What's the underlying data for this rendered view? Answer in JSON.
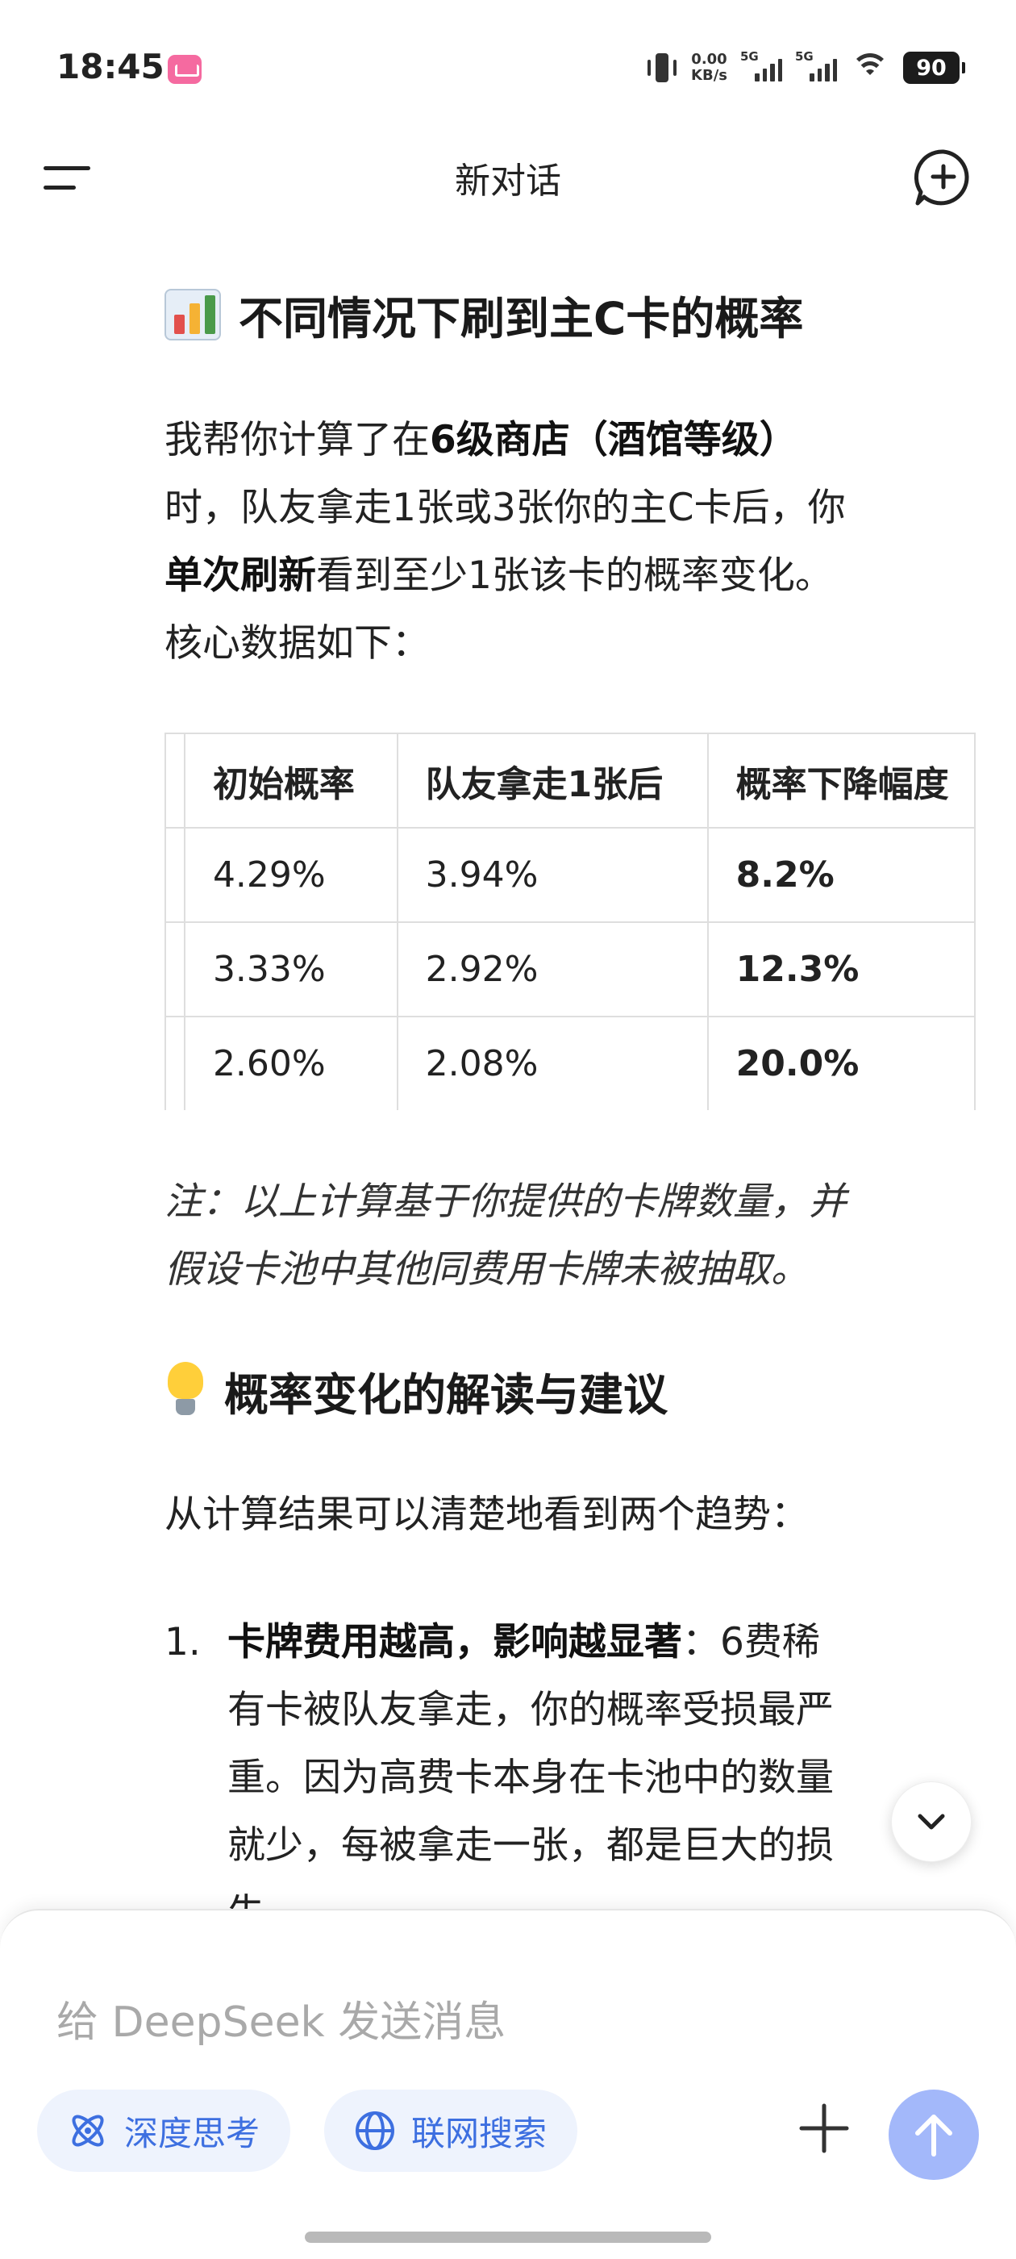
{
  "status_bar": {
    "time": "18:45",
    "net_speed_value": "0.00",
    "net_speed_unit": "KB/s",
    "signal1_label": "5G",
    "signal2_label": "5G",
    "battery": "90"
  },
  "header": {
    "title": "新对话"
  },
  "content": {
    "heading1": "不同情况下刷到主C卡的概率",
    "intro_lines": [
      [
        {
          "t": "我帮你计算了在",
          "b": false
        },
        {
          "t": "6级商店（酒馆等级）",
          "b": true
        }
      ],
      [
        {
          "t": "时，队友拿走1张或3张你的主C卡后，你",
          "b": false
        }
      ],
      [
        {
          "t": "单次刷新",
          "b": true
        },
        {
          "t": "看到至少1张该卡的概率变化。",
          "b": false
        }
      ],
      [
        {
          "t": "核心数据如下：",
          "b": false
        }
      ]
    ],
    "table": {
      "headers": [
        "",
        "初始概率",
        "队友拿走1张后",
        "概率下降幅度"
      ],
      "rows": [
        [
          "",
          "4.29%",
          "3.94%",
          "8.2%"
        ],
        [
          "",
          "3.33%",
          "2.92%",
          "12.3%"
        ],
        [
          "",
          "2.60%",
          "2.08%",
          "20.0%"
        ]
      ]
    },
    "note_lines": [
      "注：以上计算基于你提供的卡牌数量，并",
      "假设卡池中其他同费用卡牌未被抽取。"
    ],
    "heading2": "概率变化的解读与建议",
    "para2": "从计算结果可以清楚地看到两个趋势：",
    "list": [
      {
        "num": "1.",
        "lines": [
          [
            {
              "t": "卡牌费用越高，影响越显著",
              "b": true
            },
            {
              "t": "：6费稀",
              "b": false
            }
          ],
          [
            {
              "t": "有卡被队友拿走，你的概率受损最严",
              "b": false
            }
          ],
          [
            {
              "t": "重。因为高费卡本身在卡池中的数量",
              "b": false
            }
          ],
          [
            {
              "t": "就少，每被拿走一张，都是巨大的损",
              "b": false
            }
          ],
          [
            {
              "t": "失。",
              "b": false
            }
          ]
        ]
      }
    ]
  },
  "input": {
    "placeholder": "给 DeepSeek 发送消息",
    "chip_deep_think": "深度思考",
    "chip_web_search": "联网搜索"
  },
  "icons": {
    "menu": "menu-icon",
    "new_chat": "new-chat-icon",
    "scroll_down": "chevron-down-icon",
    "deep_think": "atom-icon",
    "web_search": "globe-icon",
    "plus": "plus-icon",
    "send": "arrow-up-icon"
  },
  "colors": {
    "accent": "#3d6fe0",
    "chip_bg": "#eef3fd",
    "send_btn": "#a3b8fa"
  }
}
